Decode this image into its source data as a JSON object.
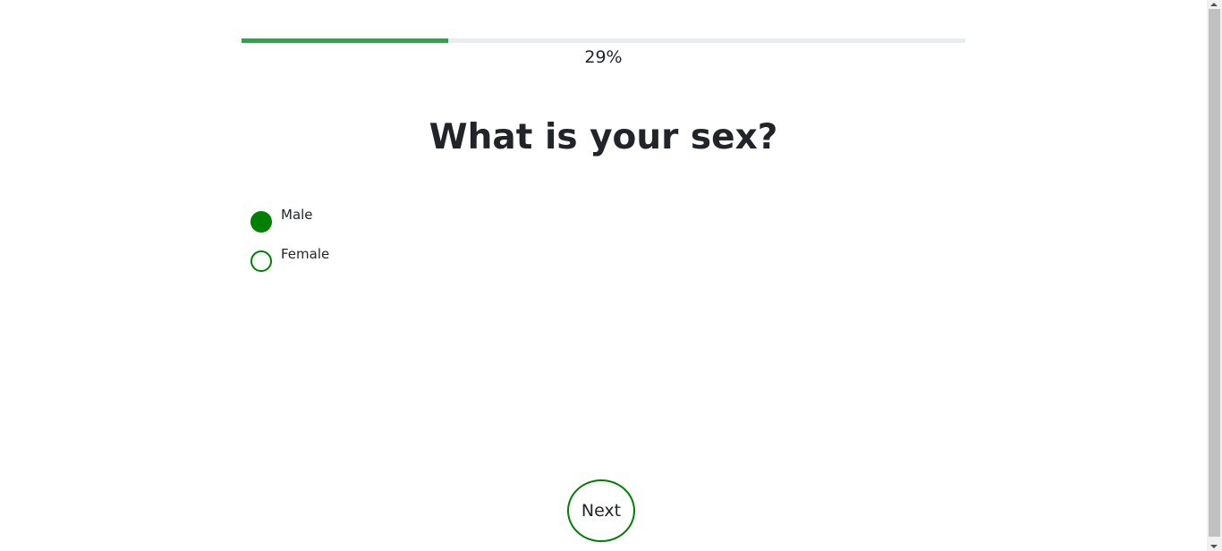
{
  "progress": {
    "value": 0.285,
    "label": "29%",
    "fill_color": "#28a745",
    "track_color": "#e9ecef"
  },
  "question": {
    "title": "What is your sex?"
  },
  "options": [
    {
      "label": "Male",
      "selected": true
    },
    {
      "label": "Female",
      "selected": false
    }
  ],
  "accent_color": "#008000",
  "next_button": {
    "label": "Next"
  }
}
